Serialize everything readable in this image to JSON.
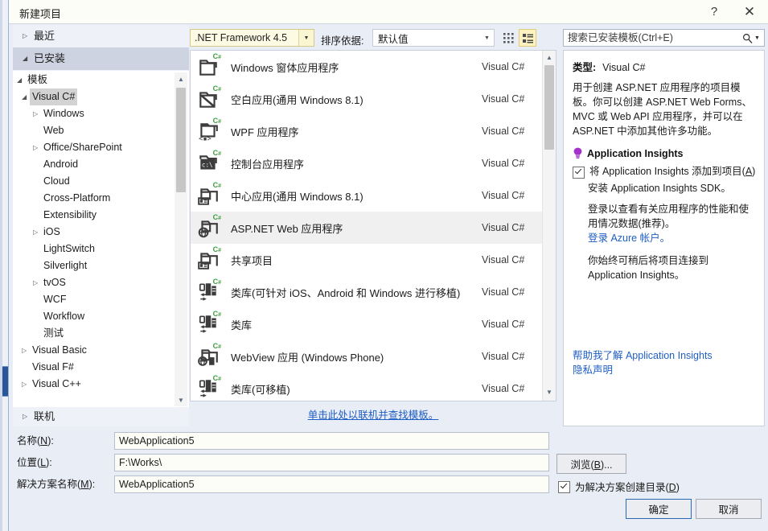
{
  "window": {
    "title": "新建项目",
    "help_label": "?",
    "close_label": "✕"
  },
  "sidebar": {
    "recent": {
      "label": "最近",
      "arrow": "▷"
    },
    "installed": {
      "label": "已安装",
      "arrow": "◢"
    },
    "online": {
      "label": "联机",
      "arrow": "▷"
    },
    "tree": [
      {
        "label": "模板",
        "indent": 0,
        "arrow": "◢",
        "selected": false
      },
      {
        "label": "Visual C#",
        "indent": 1,
        "arrow": "◢",
        "selected": true
      },
      {
        "label": "Windows",
        "indent": 2,
        "arrow": "▷",
        "selected": false
      },
      {
        "label": "Web",
        "indent": 2,
        "arrow": "",
        "selected": false
      },
      {
        "label": "Office/SharePoint",
        "indent": 2,
        "arrow": "▷",
        "selected": false
      },
      {
        "label": "Android",
        "indent": 2,
        "arrow": "",
        "selected": false
      },
      {
        "label": "Cloud",
        "indent": 2,
        "arrow": "",
        "selected": false
      },
      {
        "label": "Cross-Platform",
        "indent": 2,
        "arrow": "",
        "selected": false
      },
      {
        "label": "Extensibility",
        "indent": 2,
        "arrow": "",
        "selected": false
      },
      {
        "label": "iOS",
        "indent": 2,
        "arrow": "▷",
        "selected": false
      },
      {
        "label": "LightSwitch",
        "indent": 2,
        "arrow": "",
        "selected": false
      },
      {
        "label": "Silverlight",
        "indent": 2,
        "arrow": "",
        "selected": false
      },
      {
        "label": "tvOS",
        "indent": 2,
        "arrow": "▷",
        "selected": false
      },
      {
        "label": "WCF",
        "indent": 2,
        "arrow": "",
        "selected": false
      },
      {
        "label": "Workflow",
        "indent": 2,
        "arrow": "",
        "selected": false
      },
      {
        "label": "测试",
        "indent": 2,
        "arrow": "",
        "selected": false
      },
      {
        "label": "Visual Basic",
        "indent": 1,
        "arrow": "▷",
        "selected": false
      },
      {
        "label": "Visual F#",
        "indent": 1,
        "arrow": "",
        "selected": false
      },
      {
        "label": "Visual C++",
        "indent": 1,
        "arrow": "▷",
        "selected": false
      }
    ]
  },
  "toolbar": {
    "framework_value": ".NET Framework 4.5",
    "sort_label": "排序依据:",
    "sort_value": "默认值",
    "view_tiles_name": "tiles-view-icon",
    "view_list_name": "list-view-icon"
  },
  "search": {
    "placeholder": "搜索已安装模板(Ctrl+E)",
    "value": ""
  },
  "templates": {
    "lang": "Visual C#",
    "items": [
      {
        "name": "Windows 窗体应用程序",
        "lang": "Visual C#",
        "icon": "winforms-project-icon",
        "selected": false
      },
      {
        "name": "空白应用(通用 Windows 8.1)",
        "lang": "Visual C#",
        "icon": "blank-app-project-icon",
        "selected": false
      },
      {
        "name": "WPF 应用程序",
        "lang": "Visual C#",
        "icon": "wpf-project-icon",
        "selected": false
      },
      {
        "name": "控制台应用程序",
        "lang": "Visual C#",
        "icon": "console-project-icon",
        "selected": false
      },
      {
        "name": "中心应用(通用 Windows 8.1)",
        "lang": "Visual C#",
        "icon": "hub-app-project-icon",
        "selected": false
      },
      {
        "name": "ASP.NET Web 应用程序",
        "lang": "Visual C#",
        "icon": "aspnet-web-project-icon",
        "selected": true
      },
      {
        "name": "共享项目",
        "lang": "Visual C#",
        "icon": "shared-project-icon",
        "selected": false
      },
      {
        "name": "类库(可针对 iOS、Android 和 Windows 进行移植)",
        "lang": "Visual C#",
        "icon": "portable-library-icon",
        "selected": false
      },
      {
        "name": "类库",
        "lang": "Visual C#",
        "icon": "portable-library-icon",
        "selected": false
      },
      {
        "name": "WebView 应用 (Windows Phone)",
        "lang": "Visual C#",
        "icon": "webview-phone-icon",
        "selected": false
      },
      {
        "name": "类库(可移植)",
        "lang": "Visual C#",
        "icon": "portable-library-icon",
        "selected": false
      }
    ],
    "online_link": "单击此处以联机并查找模板。"
  },
  "info": {
    "type_key": "类型:",
    "type_value": "Visual C#",
    "description": "用于创建 ASP.NET 应用程序的项目模板。你可以创建 ASP.NET Web Forms、MVC 或 Web API 应用程序，并可以在 ASP.NET 中添加其他许多功能。",
    "ai_heading": "Application Insights",
    "ai_checkbox_label": "将 Application Insights 添加到项目(A)",
    "ai_checkbox_checked": true,
    "ai_sdk_note": "安装 Application Insights SDK。",
    "ai_signin_note": "登录以查看有关应用程序的性能和使用情况数据(推荐)。",
    "ai_signin_link": "登录 Azure 帐户。",
    "ai_later_note": "你始终可稍后将项目连接到 Application Insights。",
    "help_link": "帮助我了解 Application Insights",
    "privacy_link": "隐私声明"
  },
  "form": {
    "name_label": "名称(N):",
    "name_value": "WebApplication5",
    "location_label": "位置(L):",
    "location_value": "F:\\Works\\",
    "solution_label": "解决方案名称(M):",
    "solution_value": "WebApplication5",
    "browse_label": "浏览(B)...",
    "create_dir_label": "为解决方案创建目录(D)",
    "create_dir_checked": true,
    "ok_label": "确定",
    "cancel_label": "取消"
  },
  "colors": {
    "dialog_bg": "#e9edf5",
    "accent_blue": "#2a5699",
    "link_blue": "#1f5ec4",
    "highlight_yellow": "#fdfbe3",
    "csharp_green": "#3f9d3f"
  }
}
